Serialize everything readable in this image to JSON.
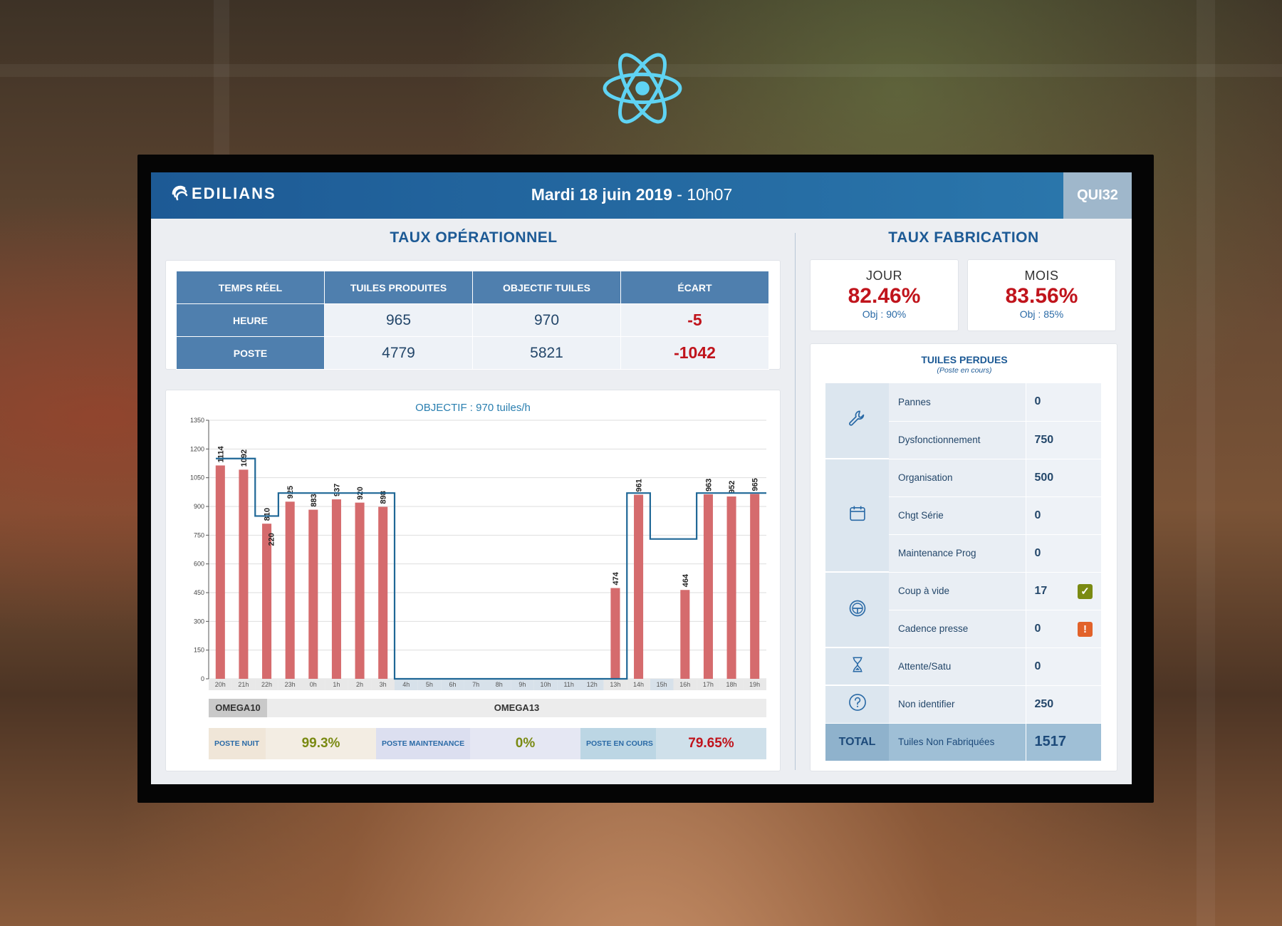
{
  "header": {
    "logo_text": "EDILIANS",
    "date": "Mardi 18 juin 2019",
    "separator": "-",
    "time": "10h07",
    "machine": "QUI32"
  },
  "operational": {
    "title": "TAUX OPÉRATIONNEL",
    "columns": [
      "TEMPS RÉEL",
      "TUILES PRODUITES",
      "OBJECTIF TUILES",
      "ÉCART"
    ],
    "rows": [
      {
        "label": "HEURE",
        "produced": "965",
        "objective": "970",
        "gap": "-5"
      },
      {
        "label": "POSTE",
        "produced": "4779",
        "objective": "5821",
        "gap": "-1042"
      }
    ]
  },
  "chart_data": {
    "type": "bar",
    "title": "OBJECTIF : 970 tuiles/h",
    "categories": [
      "20h",
      "21h",
      "22h",
      "23h",
      "0h",
      "1h",
      "2h",
      "3h",
      "4h",
      "5h",
      "6h",
      "7h",
      "8h",
      "9h",
      "10h",
      "11h",
      "12h",
      "13h",
      "14h",
      "15h",
      "16h",
      "17h",
      "18h",
      "19h"
    ],
    "series": [
      {
        "values": [
          1114,
          1092,
          810,
          925,
          883,
          937,
          920,
          898,
          0,
          0,
          0,
          0,
          0,
          0,
          0,
          0,
          0,
          474,
          961,
          0,
          464,
          963,
          952,
          965
        ],
        "bar_labels": [
          "1114",
          "1092",
          "810",
          "925",
          "883",
          "937",
          "920",
          "898",
          "",
          "",
          "",
          "",
          "",
          "",
          "",
          "",
          "",
          "474",
          "961",
          "",
          "464",
          "963",
          "952",
          "965"
        ],
        "inner_labels": {
          "2": "220"
        },
        "color": "#d56b6d"
      },
      {
        "values": [
          1150,
          1150,
          850,
          970,
          970,
          970,
          970,
          970,
          0,
          0,
          0,
          0,
          0,
          0,
          0,
          0,
          0,
          0,
          970,
          730,
          730,
          970,
          970,
          970
        ],
        "color": "#1f6796",
        "style": "step",
        "note": "objective"
      }
    ],
    "ylim": [
      0,
      1350
    ],
    "yticks": [
      "0",
      "150",
      "300",
      "450",
      "600",
      "750",
      "900",
      "1050",
      "1200",
      "1350"
    ],
    "xlabel": "",
    "ylabel": "",
    "grid": true
  },
  "shifts": {
    "a": "OMEGA10",
    "b": "OMEGA13"
  },
  "postes": [
    {
      "label": "POSTE NUIT",
      "value": "99.3%",
      "label_bg": "#f0e6d8",
      "value_bg": "#f3ede3",
      "value_color": "#7a8a12"
    },
    {
      "label": "POSTE MAINTENANCE",
      "value": "0%",
      "label_bg": "#dcdff0",
      "value_bg": "#e5e7f3",
      "value_color": "#7a8a12"
    },
    {
      "label": "POSTE EN COURS",
      "value": "79.65%",
      "label_bg": "#bcd6e4",
      "value_bg": "#cfe0ea",
      "value_color": "#c0141c"
    }
  ],
  "fabrication": {
    "title": "TAUX FABRICATION",
    "jour": {
      "label": "JOUR",
      "value": "82.46%",
      "obj": "Obj : 90%"
    },
    "mois": {
      "label": "MOIS",
      "value": "83.56%",
      "obj": "Obj : 85%"
    }
  },
  "pertes": {
    "title": "TUILES PERDUES",
    "subtitle": "(Poste en cours)",
    "groups": [
      {
        "icon": "wrench-icon",
        "items": [
          {
            "label": "Pannes",
            "value": "0"
          },
          {
            "label": "Dysfonctionnement",
            "value": "750"
          }
        ]
      },
      {
        "icon": "calendar-icon",
        "items": [
          {
            "label": "Organisation",
            "value": "500"
          },
          {
            "label": "Chgt Série",
            "value": "0"
          },
          {
            "label": "Maintenance Prog",
            "value": "0"
          }
        ]
      },
      {
        "icon": "steering-wheel-icon",
        "items": [
          {
            "label": "Coup à vide",
            "value": "17",
            "status": "ok"
          },
          {
            "label": "Cadence presse",
            "value": "0",
            "status": "warning"
          }
        ]
      },
      {
        "icon": "hourglass-icon",
        "items": [
          {
            "label": "Attente/Satu",
            "value": "0"
          }
        ]
      },
      {
        "icon": "question-icon",
        "items": [
          {
            "label": "Non identifier",
            "value": "250"
          }
        ]
      }
    ],
    "total": {
      "label": "TOTAL",
      "name": "Tuiles Non Fabriquées",
      "value": "1517"
    },
    "status_colors": {
      "ok": "#7a8a12",
      "warning": "#e2622a"
    }
  }
}
